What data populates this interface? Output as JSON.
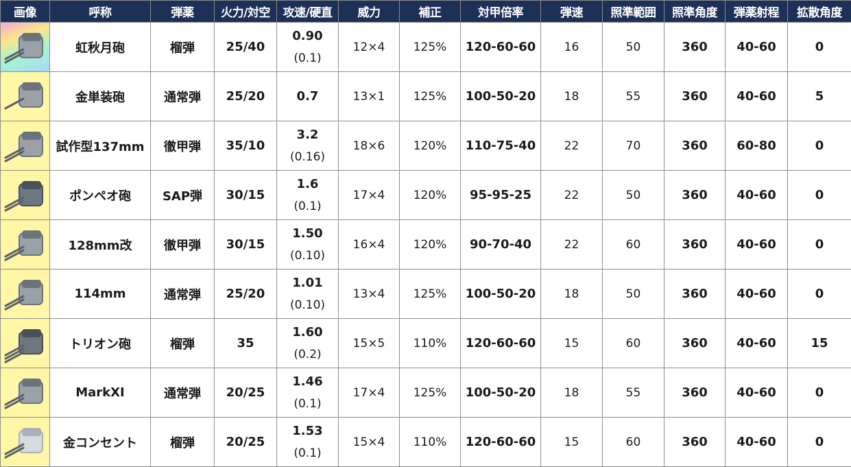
{
  "headers": {
    "image": "画像",
    "name": "呼称",
    "ammo": "弾薬",
    "firepower": "火力/対空",
    "speed": "攻速/硬直",
    "power": "威力",
    "mod": "補正",
    "armor": "対甲倍率",
    "velocity": "弾速",
    "aim_range": "照準範囲",
    "aim_angle": "照準角度",
    "range": "弾薬射程",
    "spread": "拡散角度"
  },
  "rows": [
    {
      "icon": "turret-twin-gray-icon",
      "bg": "rainbow",
      "name": "虹秋月砲",
      "ammo": "榴弾",
      "firepower": "25/40",
      "speed_main": "0.90",
      "speed_sub": "(0.1)",
      "power": "12×4",
      "mod": "125%",
      "armor": "120-60-60",
      "velocity": "16",
      "aim_range": "50",
      "aim_angle": "360",
      "range": "40-60",
      "spread": "0"
    },
    {
      "icon": "turret-single-gray-icon",
      "bg": "yellow",
      "name": "金単装砲",
      "ammo": "通常弾",
      "firepower": "25/20",
      "speed_main": "0.7",
      "speed_sub": "",
      "power": "13×1",
      "mod": "125%",
      "armor": "100-50-20",
      "velocity": "18",
      "aim_range": "55",
      "aim_angle": "360",
      "range": "40-60",
      "spread": "5"
    },
    {
      "icon": "turret-twin-gray-icon",
      "bg": "yellow",
      "name": "試作型137mm",
      "ammo": "徹甲弾",
      "firepower": "35/10",
      "speed_main": "3.2",
      "speed_sub": "(0.16)",
      "power": "18×6",
      "mod": "120%",
      "armor": "110-75-40",
      "velocity": "22",
      "aim_range": "70",
      "aim_angle": "360",
      "range": "60-80",
      "spread": "0"
    },
    {
      "icon": "turret-twin-dark-icon",
      "bg": "yellow",
      "name": "ポンペオ砲",
      "ammo": "SAP弾",
      "firepower": "30/15",
      "speed_main": "1.6",
      "speed_sub": "(0.1)",
      "power": "17×4",
      "mod": "120%",
      "armor": "95-95-25",
      "velocity": "22",
      "aim_range": "50",
      "aim_angle": "360",
      "range": "40-60",
      "spread": "0"
    },
    {
      "icon": "turret-twin-gray-icon",
      "bg": "yellow",
      "name": "128mm改",
      "ammo": "徹甲弾",
      "firepower": "30/15",
      "speed_main": "1.50",
      "speed_sub": "(0.10)",
      "power": "16×4",
      "mod": "120%",
      "armor": "90-70-40",
      "velocity": "22",
      "aim_range": "60",
      "aim_angle": "360",
      "range": "40-60",
      "spread": "0"
    },
    {
      "icon": "turret-twin-gray-icon",
      "bg": "yellow",
      "name": "114mm",
      "ammo": "通常弾",
      "firepower": "25/20",
      "speed_main": "1.01",
      "speed_sub": "(0.10)",
      "power": "13×4",
      "mod": "125%",
      "armor": "100-50-20",
      "velocity": "18",
      "aim_range": "50",
      "aim_angle": "360",
      "range": "40-60",
      "spread": "0"
    },
    {
      "icon": "turret-triple-dark-icon",
      "bg": "yellow",
      "name": "トリオン砲",
      "ammo": "榴弾",
      "firepower": "35",
      "speed_main": "1.60",
      "speed_sub": "(0.2)",
      "power": "15×5",
      "mod": "110%",
      "armor": "120-60-60",
      "velocity": "15",
      "aim_range": "60",
      "aim_angle": "360",
      "range": "40-60",
      "spread": "15"
    },
    {
      "icon": "turret-twin-gray-icon",
      "bg": "yellow",
      "name": "MarkXI",
      "ammo": "通常弾",
      "firepower": "20/25",
      "speed_main": "1.46",
      "speed_sub": "(0.1)",
      "power": "17×4",
      "mod": "125%",
      "armor": "100-50-20",
      "velocity": "18",
      "aim_range": "55",
      "aim_angle": "360",
      "range": "40-60",
      "spread": "0"
    },
    {
      "icon": "turret-twin-light-icon",
      "bg": "yellow",
      "name": "金コンセント",
      "ammo": "榴弾",
      "firepower": "20/25",
      "speed_main": "1.53",
      "speed_sub": "(0.1)",
      "power": "15×4",
      "mod": "110%",
      "armor": "120-60-60",
      "velocity": "15",
      "aim_range": "60",
      "aim_angle": "360",
      "range": "40-60",
      "spread": "0"
    }
  ],
  "colors": {
    "header_bg": "#1d3057",
    "header_text": "#ffffff",
    "image_cell_yellow": "#fff6a6",
    "grid_line": "#8c8c8c"
  }
}
